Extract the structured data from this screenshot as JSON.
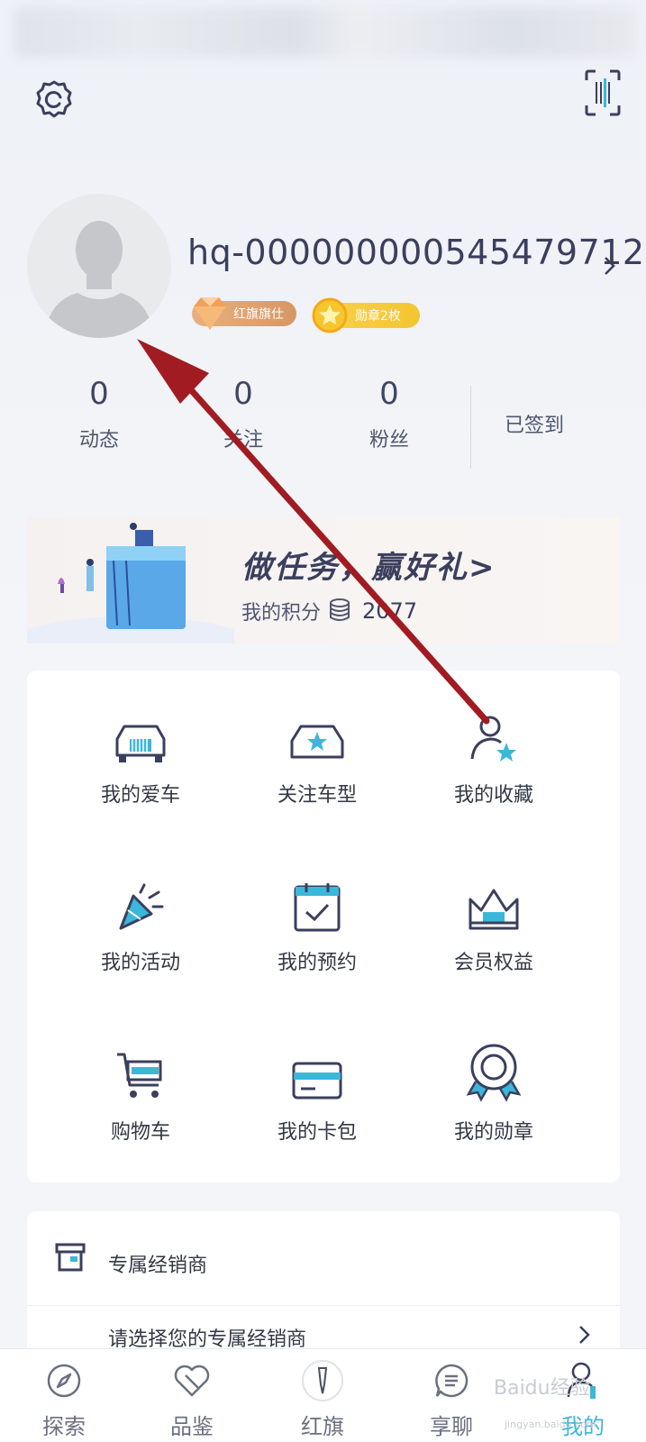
{
  "header": {
    "settings_icon": "gear-icon",
    "scan_icon": "barcode-scan-icon"
  },
  "profile": {
    "username": "hq-000000000545479712",
    "badge_rank": "红旗旗仕",
    "badge_medal": "勋章2枚"
  },
  "stats": {
    "items": [
      {
        "value": "0",
        "label": "动态"
      },
      {
        "value": "0",
        "label": "关注"
      },
      {
        "value": "0",
        "label": "粉丝"
      }
    ],
    "signin_label": "已签到"
  },
  "task_banner": {
    "title": "做任务，赢好礼>",
    "points_label": "我的积分",
    "points_value": "2077"
  },
  "grid": {
    "items": [
      {
        "label": "我的爱车",
        "icon": "car-front-icon"
      },
      {
        "label": "关注车型",
        "icon": "car-star-icon"
      },
      {
        "label": "我的收藏",
        "icon": "user-star-icon"
      },
      {
        "label": "我的活动",
        "icon": "party-popper-icon"
      },
      {
        "label": "我的预约",
        "icon": "calendar-check-icon"
      },
      {
        "label": "会员权益",
        "icon": "crown-icon"
      },
      {
        "label": "购物车",
        "icon": "shopping-cart-icon"
      },
      {
        "label": "我的卡包",
        "icon": "card-wallet-icon"
      },
      {
        "label": "我的勋章",
        "icon": "medal-icon"
      }
    ]
  },
  "dealer": {
    "title": "专属经销商",
    "select_label": "请选择您的专属经销商"
  },
  "tabbar": {
    "items": [
      {
        "label": "探索",
        "icon": "compass-icon"
      },
      {
        "label": "品鉴",
        "icon": "heart-icon"
      },
      {
        "label": "红旗",
        "icon": "hongqi-logo-icon"
      },
      {
        "label": "享聊",
        "icon": "chat-icon"
      },
      {
        "label": "我的",
        "icon": "user-icon"
      }
    ],
    "active": "我的"
  },
  "watermark": {
    "text": "Baidu经验",
    "sub": "jingyan.baidu.com"
  },
  "colors": {
    "accent": "#3bb7d9",
    "text_dark": "#3b3f5e",
    "annotation_arrow": "#a01c22"
  }
}
